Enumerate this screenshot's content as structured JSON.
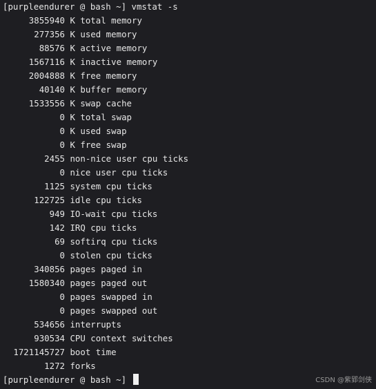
{
  "prompt": "[purpleendurer @ bash ~]",
  "command": "vmstat -s",
  "rows": [
    {
      "value": "3855940",
      "label": "K total memory"
    },
    {
      "value": "277356",
      "label": "K used memory"
    },
    {
      "value": "88576",
      "label": "K active memory"
    },
    {
      "value": "1567116",
      "label": "K inactive memory"
    },
    {
      "value": "2004888",
      "label": "K free memory"
    },
    {
      "value": "40140",
      "label": "K buffer memory"
    },
    {
      "value": "1533556",
      "label": "K swap cache"
    },
    {
      "value": "0",
      "label": "K total swap"
    },
    {
      "value": "0",
      "label": "K used swap"
    },
    {
      "value": "0",
      "label": "K free swap"
    },
    {
      "value": "2455",
      "label": "non-nice user cpu ticks"
    },
    {
      "value": "0",
      "label": "nice user cpu ticks"
    },
    {
      "value": "1125",
      "label": "system cpu ticks"
    },
    {
      "value": "122725",
      "label": "idle cpu ticks"
    },
    {
      "value": "949",
      "label": "IO-wait cpu ticks"
    },
    {
      "value": "142",
      "label": "IRQ cpu ticks"
    },
    {
      "value": "69",
      "label": "softirq cpu ticks"
    },
    {
      "value": "0",
      "label": "stolen cpu ticks"
    },
    {
      "value": "340856",
      "label": "pages paged in"
    },
    {
      "value": "1580340",
      "label": "pages paged out"
    },
    {
      "value": "0",
      "label": "pages swapped in"
    },
    {
      "value": "0",
      "label": "pages swapped out"
    },
    {
      "value": "534656",
      "label": "interrupts"
    },
    {
      "value": "930534",
      "label": "CPU context switches"
    },
    {
      "value": "1721145727",
      "label": "boot time"
    },
    {
      "value": "1272",
      "label": "forks"
    }
  ],
  "final_prompt": "[purpleendurer @ bash ~]",
  "watermark": "CSDN @紫郢剑侠"
}
